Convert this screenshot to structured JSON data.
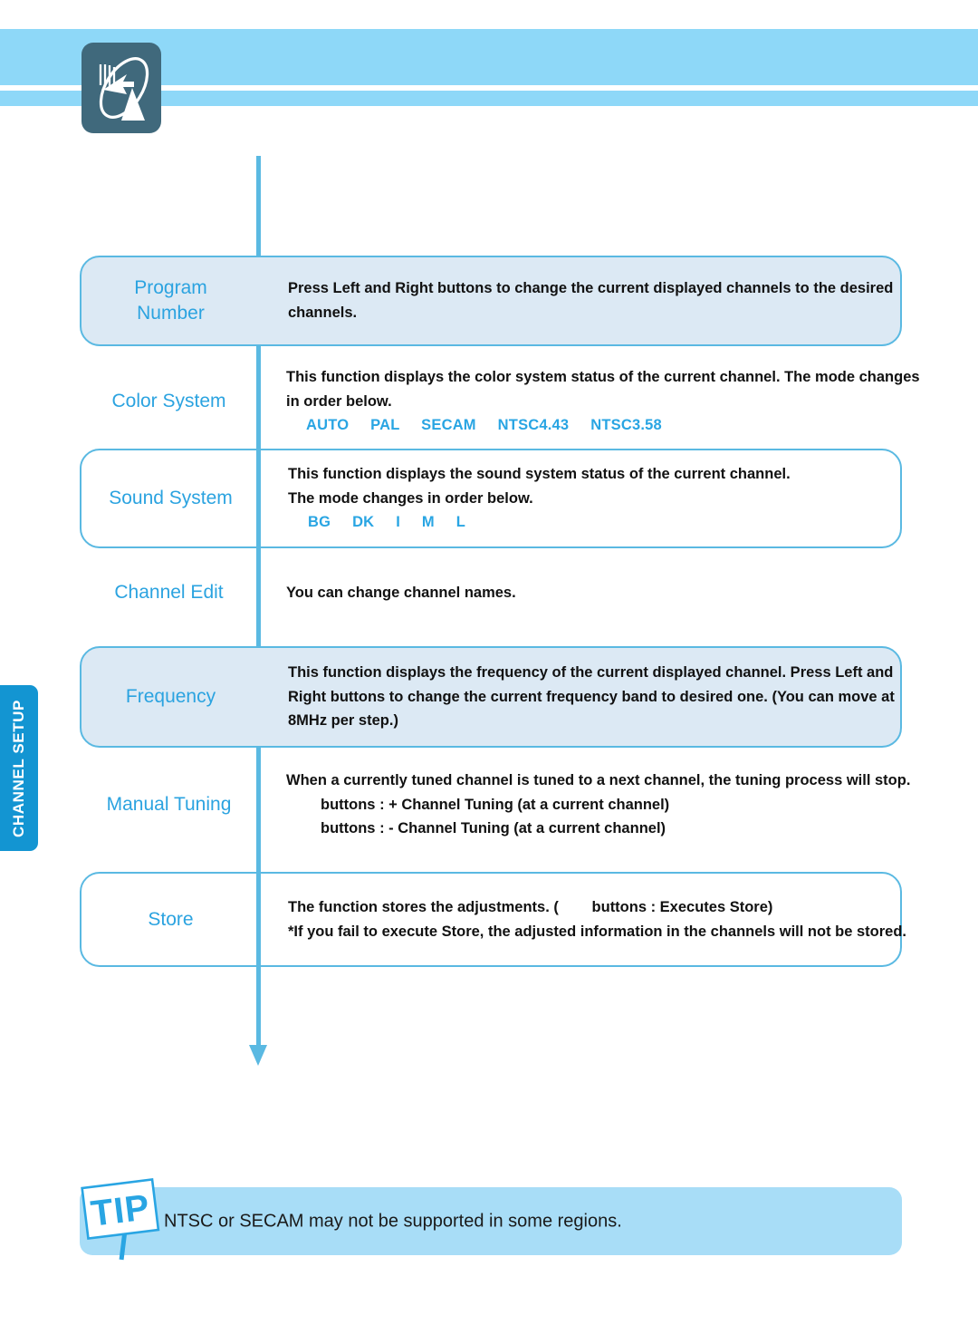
{
  "header": {
    "icon_name": "satellite-dish-icon",
    "band_color": "#8ed8f8"
  },
  "section_tab": {
    "label": "CHANNEL SETUP",
    "color": "#1395d2"
  },
  "colors": {
    "accent_blue": "#2ba3e0",
    "border_blue": "#5ab9e2",
    "fill_blue": "#dce9f4",
    "tip_blue": "#a8ddf7",
    "icon_dark": "#40697c"
  },
  "rows": [
    {
      "label": "Program\nNumber",
      "label_line1": "Program",
      "label_line2": "Number",
      "style": "filled-boxed",
      "lines": [
        "Press Left and Right buttons to change the current displayed channels to the desired",
        "channels."
      ]
    },
    {
      "label": "Color System",
      "style": "plain",
      "lines": [
        "This function displays the color system status of the current channel. The mode changes",
        "in order below."
      ],
      "modes": "AUTO     PAL     SECAM     NTSC4.43     NTSC3.58"
    },
    {
      "label": "Sound System",
      "style": "boxed",
      "lines": [
        "This function displays the sound system status of the current channel.",
        "The mode changes in order below."
      ],
      "modes": "BG     DK     I     M     L"
    },
    {
      "label": "Channel Edit",
      "style": "plain",
      "lines": [
        "You can change channel names."
      ]
    },
    {
      "label": "Frequency",
      "style": "filled-boxed",
      "lines": [
        "This function displays the frequency of the current displayed channel. Press Left and",
        "Right buttons to change the current frequency band to desired one. (You can move at",
        "8MHz per step.)"
      ]
    },
    {
      "label": "Manual Tuning",
      "style": "plain",
      "lines": [
        "When a currently tuned channel is tuned to a next channel, the tuning process will stop."
      ],
      "indented_lines": [
        "buttons : + Channel Tuning (at a current channel)",
        "buttons : - Channel Tuning (at a current channel)"
      ]
    },
    {
      "label": "Store",
      "style": "boxed",
      "lines": [
        "The function stores the adjustments. (        buttons : Executes Store)",
        "*If you fail to execute Store, the adjusted information in the channels will not be stored."
      ]
    }
  ],
  "tip": {
    "sign_label": "TIP",
    "text": "NTSC or SECAM may not be supported in some regions."
  }
}
